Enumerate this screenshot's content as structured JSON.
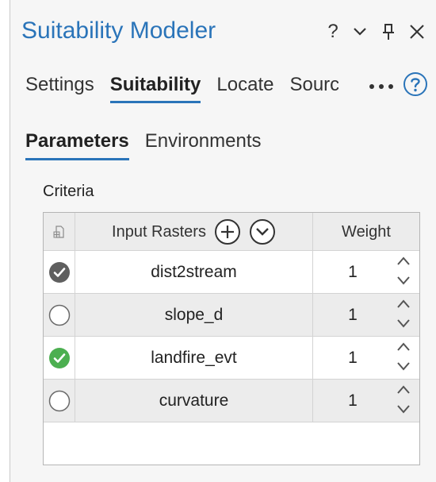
{
  "title": "Suitability Modeler",
  "title_buttons": {
    "help_glyph": "?"
  },
  "tabs": [
    {
      "label": "Settings",
      "active": false
    },
    {
      "label": "Suitability",
      "active": true
    },
    {
      "label": "Locate",
      "active": false
    },
    {
      "label": "Source",
      "active": false
    }
  ],
  "subtabs": [
    {
      "label": "Parameters",
      "active": true
    },
    {
      "label": "Environments",
      "active": false
    }
  ],
  "criteria": {
    "label": "Criteria",
    "columns": {
      "rasters": "Input Rasters",
      "weight": "Weight"
    },
    "rows": [
      {
        "name": "dist2stream",
        "weight": "1",
        "state": "checked-gray"
      },
      {
        "name": "slope_d",
        "weight": "1",
        "state": "unchecked"
      },
      {
        "name": "landfire_evt",
        "weight": "1",
        "state": "checked-green"
      },
      {
        "name": "curvature",
        "weight": "1",
        "state": "unchecked"
      }
    ]
  },
  "colors": {
    "accent": "#2a74b9",
    "check_gray": "#5f5f5f",
    "check_green": "#4caf50"
  },
  "icons": {
    "title_bar": [
      "help-icon",
      "chevron-down-icon",
      "pin-icon",
      "close-icon"
    ],
    "tabs_bar": [
      "more-icon",
      "help-circle-icon"
    ],
    "table_header": [
      "raster-table-icon",
      "add-circle-icon",
      "chevron-down-circle-icon"
    ],
    "row": [
      "status-check-icon",
      "spin-up-icon",
      "spin-down-icon"
    ]
  }
}
